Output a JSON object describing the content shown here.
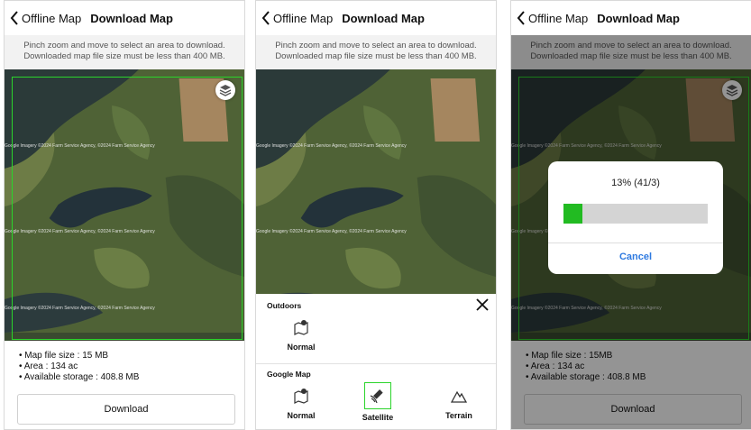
{
  "screens": [
    {
      "back_label": "Offline Map",
      "title": "Download Map",
      "instructions": [
        "Pinch zoom and move to select an area to download.",
        "Downloaded map file size must be less than 400 MB."
      ],
      "attribution": "Google Imagery ©2024 Farm Service Agency, ©2024 Farm Service Agency",
      "info": [
        "Map file size : 15 MB",
        "Area : 134 ac",
        "Available storage : 408.8 MB"
      ],
      "download_label": "Download"
    },
    {
      "back_label": "Offline Map",
      "title": "Download Map",
      "instructions": [
        "Pinch zoom and move to select an area to download.",
        "Downloaded map file size must be less than 400 MB."
      ],
      "attribution": "Google Imagery ©2024 Farm Service Agency, ©2024 Farm Service Agency",
      "sheet": {
        "outdoors_label": "Outdoors",
        "outdoors_options": [
          {
            "label": "Normal",
            "icon": "map-pin-icon"
          }
        ],
        "google_label": "Google Map",
        "google_options": [
          {
            "label": "Normal",
            "icon": "map-pin-icon"
          },
          {
            "label": "Satellite",
            "icon": "satellite-icon",
            "selected": true
          },
          {
            "label": "Terrain",
            "icon": "mountain-icon"
          }
        ]
      }
    },
    {
      "back_label": "Offline Map",
      "title": "Download Map",
      "instructions": [
        "Pinch zoom and move to select an area to download.",
        "Downloaded map file size must be less than 400 MB."
      ],
      "attribution": "Google Imagery ©2024 Farm Service Agency, ©2024 Farm Service Agency",
      "info": [
        "Map file size : 15MB",
        "Area : 134 ac",
        "Available storage : 408.8 MB"
      ],
      "download_label": "Download",
      "progress": {
        "text": "13% (41/3)",
        "fraction": 0.13,
        "cancel_label": "Cancel"
      }
    }
  ],
  "colors": {
    "selection": "#2bd42b",
    "progress": "#22bb22",
    "cancel": "#2e7ae0",
    "dim_overlay": "rgba(0,0,0,0.42)"
  }
}
